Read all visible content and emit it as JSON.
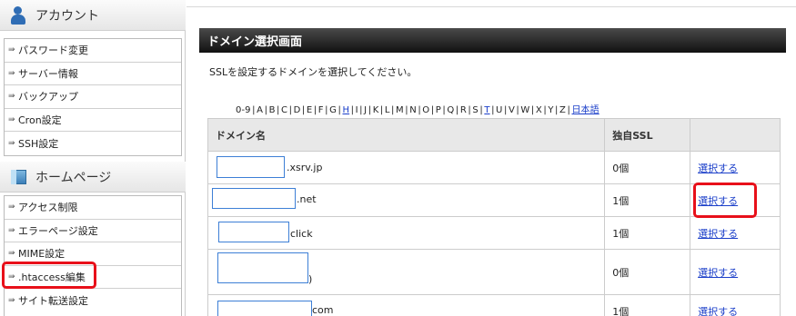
{
  "sidebar": {
    "account_section": {
      "label": "アカウント",
      "icon": "person-icon"
    },
    "account_items": [
      {
        "label": "パスワード変更"
      },
      {
        "label": "サーバー情報"
      },
      {
        "label": "バックアップ"
      },
      {
        "label": "Cron設定"
      },
      {
        "label": "SSH設定"
      }
    ],
    "homepage_section": {
      "label": "ホームページ",
      "icon": "homepage-icon"
    },
    "homepage_items": [
      {
        "label": "アクセス制限"
      },
      {
        "label": "エラーページ設定"
      },
      {
        "label": "MIME設定"
      },
      {
        "label": ".htaccess編集",
        "highlighted": true
      },
      {
        "label": "サイト転送設定"
      }
    ],
    "item_arrow": "⇛"
  },
  "main": {
    "title": "ドメイン選択画面",
    "instruction": "SSLを設定するドメインを選択してください。",
    "alpha_nav": [
      "0-9",
      "A",
      "B",
      "C",
      "D",
      "E",
      "F",
      "G",
      "H",
      "I",
      "J",
      "K",
      "L",
      "M",
      "N",
      "O",
      "P",
      "Q",
      "R",
      "S",
      "T",
      "U",
      "V",
      "W",
      "X",
      "Y",
      "Z",
      "日本語"
    ],
    "alpha_nav_links": [
      "H",
      "T",
      "日本語"
    ],
    "table": {
      "headers": {
        "domain": "ドメイン名",
        "ssl": "独自SSL",
        "action": ""
      },
      "rows": [
        {
          "suffix": ".xsrv.jp",
          "ssl": "0個",
          "action": "選択する"
        },
        {
          "suffix": ".net",
          "ssl": "1個",
          "action": "選択する",
          "highlighted": true
        },
        {
          "suffix": "click",
          "ssl": "1個",
          "action": "選択する"
        },
        {
          "suffix": ")",
          "ssl": "0個",
          "action": "選択する"
        },
        {
          "suffix": "com",
          "ssl": "1個",
          "action": "選択する"
        }
      ]
    }
  },
  "colors": {
    "highlight": "#e8101a",
    "link": "#1a3ec9",
    "title_bar": "#222222",
    "input_border": "#3d7fd6"
  }
}
